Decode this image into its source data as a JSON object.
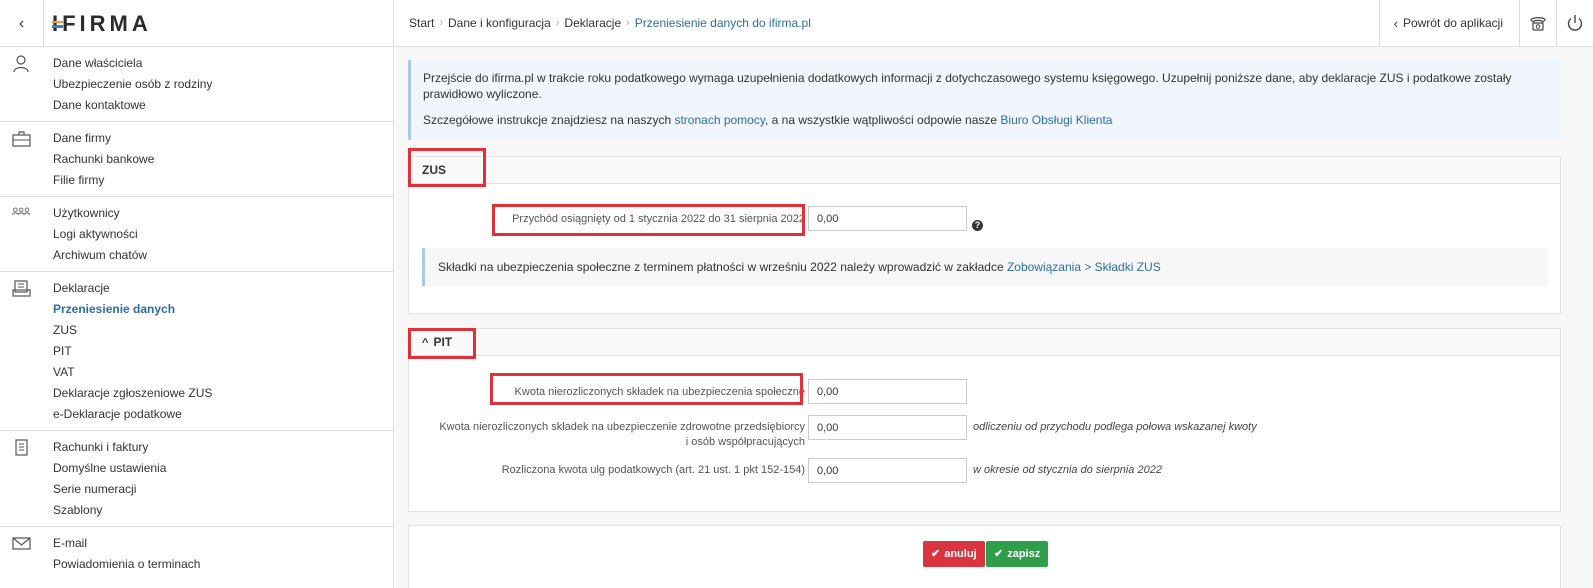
{
  "sidebar": {
    "logo": "IFIRMA",
    "groups": [
      {
        "icon": "user-icon",
        "items": [
          "Dane właściciela",
          "Ubezpieczenie osób z rodziny",
          "Dane kontaktowe"
        ]
      },
      {
        "icon": "briefcase-icon",
        "items": [
          "Dane firmy",
          "Rachunki bankowe",
          "Filie firmy"
        ]
      },
      {
        "icon": "users-icon",
        "items": [
          "Użytkownicy",
          "Logi aktywności",
          "Archiwum chatów"
        ]
      },
      {
        "icon": "declarations-icon",
        "items": [
          "Deklaracje",
          "Przeniesienie danych",
          "ZUS",
          "PIT",
          "VAT",
          "Deklaracje zgłoszeniowe ZUS",
          "e-Deklaracje podatkowe"
        ]
      },
      {
        "icon": "invoice-icon",
        "items": [
          "Rachunki i faktury",
          "Domyślne ustawienia",
          "Serie numeracji",
          "Szablony"
        ]
      },
      {
        "icon": "mail-icon",
        "items": [
          "E-mail",
          "Powiadomienia o terminach"
        ]
      }
    ]
  },
  "breadcrumb": {
    "items": [
      "Start",
      "Dane i konfiguracja",
      "Deklaracje"
    ],
    "current": "Przeniesienie danych do ifirma.pl"
  },
  "topbar": {
    "back_label": "Powrót do aplikacji"
  },
  "info": {
    "line1": "Przejście do ifirma.pl w trakcie roku podatkowego wymaga uzupełnienia dodatkowych informacji z dotychczasowego systemu księgowego. Uzupełnij poniższe dane, aby deklaracje ZUS i podatkowe zostały prawidłowo wyliczone.",
    "line2_prefix": "Szczegółowe instrukcje znajdziesz na naszych ",
    "line2_link1": "stronach pomocy",
    "line2_mid": ", a na wszystkie wątpliwości odpowie nasze ",
    "line2_link2": "Biuro Obsługi Klienta"
  },
  "zus": {
    "title": "ZUS",
    "field_label": "Przychód osiągnięty od 1 stycznia 2022 do 31 sierpnia 2022",
    "field_value": "0,00",
    "note_prefix": "Składki na ubezpieczenia społeczne z terminem płatności w wrześniu 2022 należy wprowadzić w zakładce ",
    "note_link": "Zobowiązania > Składki ZUS"
  },
  "pit": {
    "title": "PIT",
    "chevron": "^",
    "fields": [
      {
        "label": "Kwota nierozliczonych składek na ubezpieczenia społeczne",
        "value": "0,00",
        "hint": ""
      },
      {
        "label": "Kwota nierozliczonych składek na ubezpieczenie zdrowotne przedsiębiorcy i osób współpracujących",
        "value": "0,00",
        "hint": "odliczeniu od przychodu podlega połowa wskazanej kwoty"
      },
      {
        "label": "Rozliczona kwota ulg podatkowych (art. 21 ust. 1 pkt 152-154)",
        "value": "0,00",
        "hint": "w okresie od stycznia do sierpnia 2022"
      }
    ]
  },
  "actions": {
    "cancel_label": "anuluj",
    "save_label": "zapisz"
  },
  "colors": {
    "link": "#2c6ea3",
    "cancel": "#d9343f",
    "save": "#2f9e4a",
    "highlight": "#e0303a"
  }
}
